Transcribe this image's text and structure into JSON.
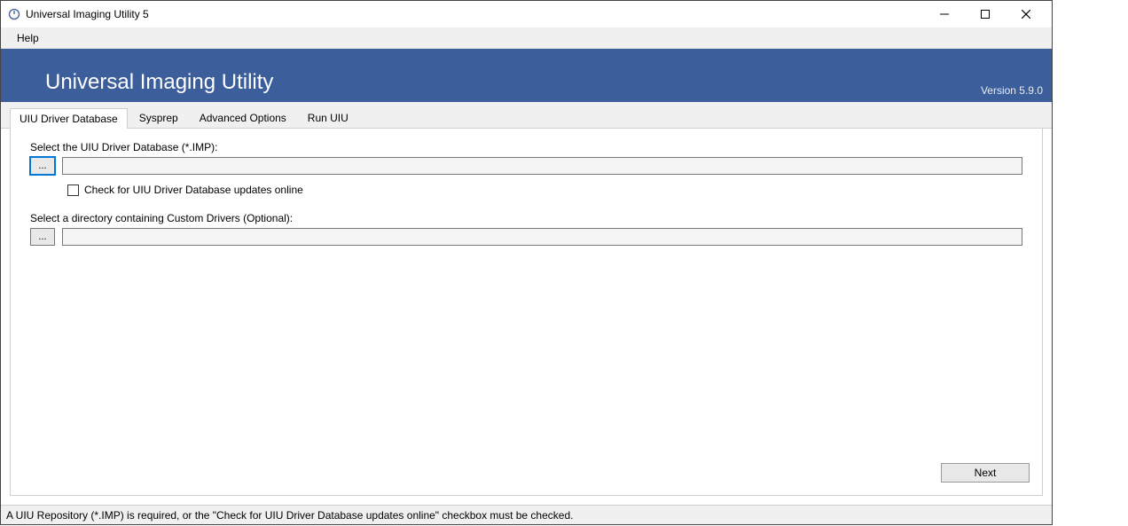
{
  "window": {
    "title": "Universal Imaging Utility 5"
  },
  "menubar": {
    "help": "Help"
  },
  "banner": {
    "title": "Universal Imaging Utility",
    "version": "Version 5.9.0"
  },
  "tabs": {
    "driver_db": "UIU Driver Database",
    "sysprep": "Sysprep",
    "advanced": "Advanced Options",
    "run": "Run UIU"
  },
  "panel": {
    "db_label": "Select the UIU Driver Database (*.IMP):",
    "browse1": "...",
    "db_value": "",
    "check_updates_label": "Check for UIU Driver Database updates online",
    "custom_label": "Select a directory containing Custom Drivers (Optional):",
    "browse2": "...",
    "custom_value": "",
    "next": "Next"
  },
  "status": {
    "text": "A UIU Repository (*.IMP) is required, or the \"Check for UIU Driver Database updates online\" checkbox must be checked."
  }
}
